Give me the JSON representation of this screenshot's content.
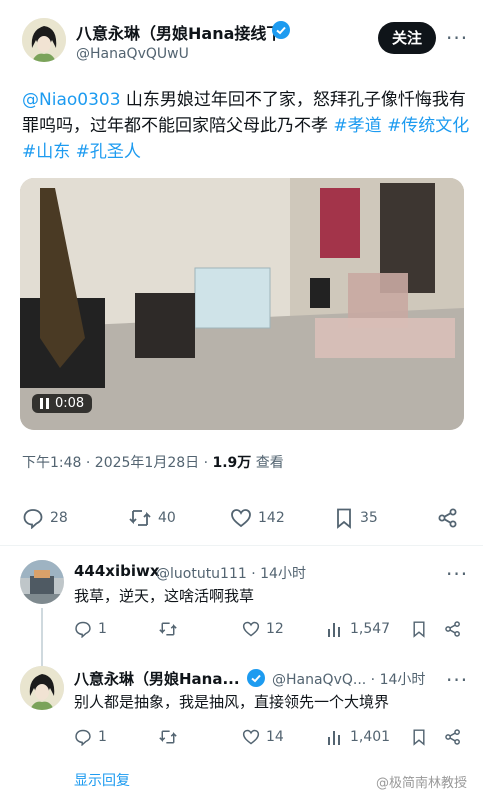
{
  "post": {
    "author_name": "八意永琳（男娘Hana接线下",
    "author_handle": "@HanaQvQUwU",
    "follow_label": "关注",
    "mention": "@Niao0303",
    "text_main": " 山东男娘过年回不了家，怒拜孔子像忏悔我有罪呜吗，过年都不能回家陪父母此乃不孝 ",
    "hashtags": [
      "#孝道",
      "#传统文化",
      "#山东",
      "#孔圣人"
    ],
    "video_time": "0:08",
    "timestamp": "下午1:48 · 2025年1月28日 · ",
    "views": "1.9万",
    "views_label": " 查看",
    "replies": "28",
    "retweets": "40",
    "likes": "142",
    "bookmarks": "35"
  },
  "replies": [
    {
      "name": "444xibiwx",
      "handle": "@luotutu111 · 14小时",
      "text": "我草，逆天，这啥活啊我草",
      "replies": "1",
      "likes": "12",
      "views": "1,547"
    },
    {
      "name": "八意永琳（男娘Hana...",
      "handle": "@HanaQvQ... · 14小时",
      "text": "别人都是抽象，我是抽风，直接领先一个大境界",
      "replies": "1",
      "likes": "14",
      "views": "1,401"
    }
  ],
  "show_replies": "显示回复",
  "watermark": "@极简南林教授",
  "colors": {
    "accent": "#1d9bf0",
    "text": "#0f1419",
    "muted": "#536471"
  }
}
